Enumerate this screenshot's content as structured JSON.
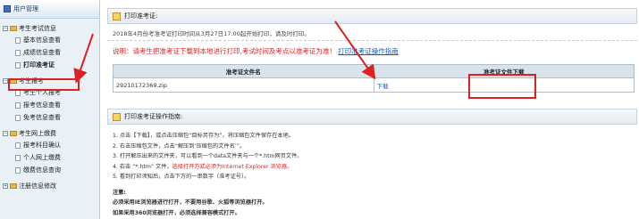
{
  "sidebar": {
    "header": "用户管理",
    "groups": [
      {
        "label": "考生考试信息",
        "items": [
          "基本信息查看",
          "成绩信息查看",
          "打印准考证"
        ]
      },
      {
        "label": "考生报考",
        "items": [
          "考生个人报考",
          "报考信息查看",
          "免考信息查看"
        ]
      },
      {
        "label": "考生网上缴费",
        "items": [
          "报考科目确认",
          "个人网上缴费",
          "缴费信息查询"
        ]
      },
      {
        "label": "注册信息修改",
        "items": []
      }
    ]
  },
  "print_panel": {
    "title": "打印准考证:",
    "info": "2018年4月份考准考证打印时间从3月27日17:00起开始打印，请及时打印。",
    "desc": "说明：请考生把准考证下载到本地进行打印,考试时间及考点以准考证为准！",
    "guide_link": "打印准考证操作指南",
    "table": {
      "headers": [
        "准考证文件名",
        "准考证文件下载"
      ],
      "rows": [
        {
          "filename": "29210172369.zip",
          "download": "下载"
        }
      ]
    }
  },
  "guide_panel": {
    "title": "打印准考证操作指南:",
    "steps": [
      {
        "text": "1. 点击【下载】，或点击压缩包“目标另存为”，将压缩包文件保存在本地。",
        "highlight": ""
      },
      {
        "text": "2. 右击压缩包文件，点击“解压到‘压缩包的文件名’”。",
        "highlight": ""
      },
      {
        "text": "3. 打开解压出来的文件夹，可以看到一个data文件夹与一个*.htm网页文件。",
        "highlight": ""
      },
      {
        "text": "4. 右击 “*.htm” 文件，",
        "highlight": "选择打开方式必须为Internet Explorer 浏览器。"
      },
      {
        "text": "5. 看到打印须知后，点击下方的一串数字（准考证号）。",
        "highlight": ""
      }
    ],
    "note_title": "注意:",
    "notes": [
      "必须采用IE浏览器进行打开，不要用谷歌、火狐等浏览器打开。",
      "如果采用360浏览器打开，必须选择兼容模式打开。"
    ]
  },
  "colors": {
    "highlight": "#e02020",
    "link": "#1e5bb0",
    "sidebar_bg": "#e9f1f7"
  }
}
